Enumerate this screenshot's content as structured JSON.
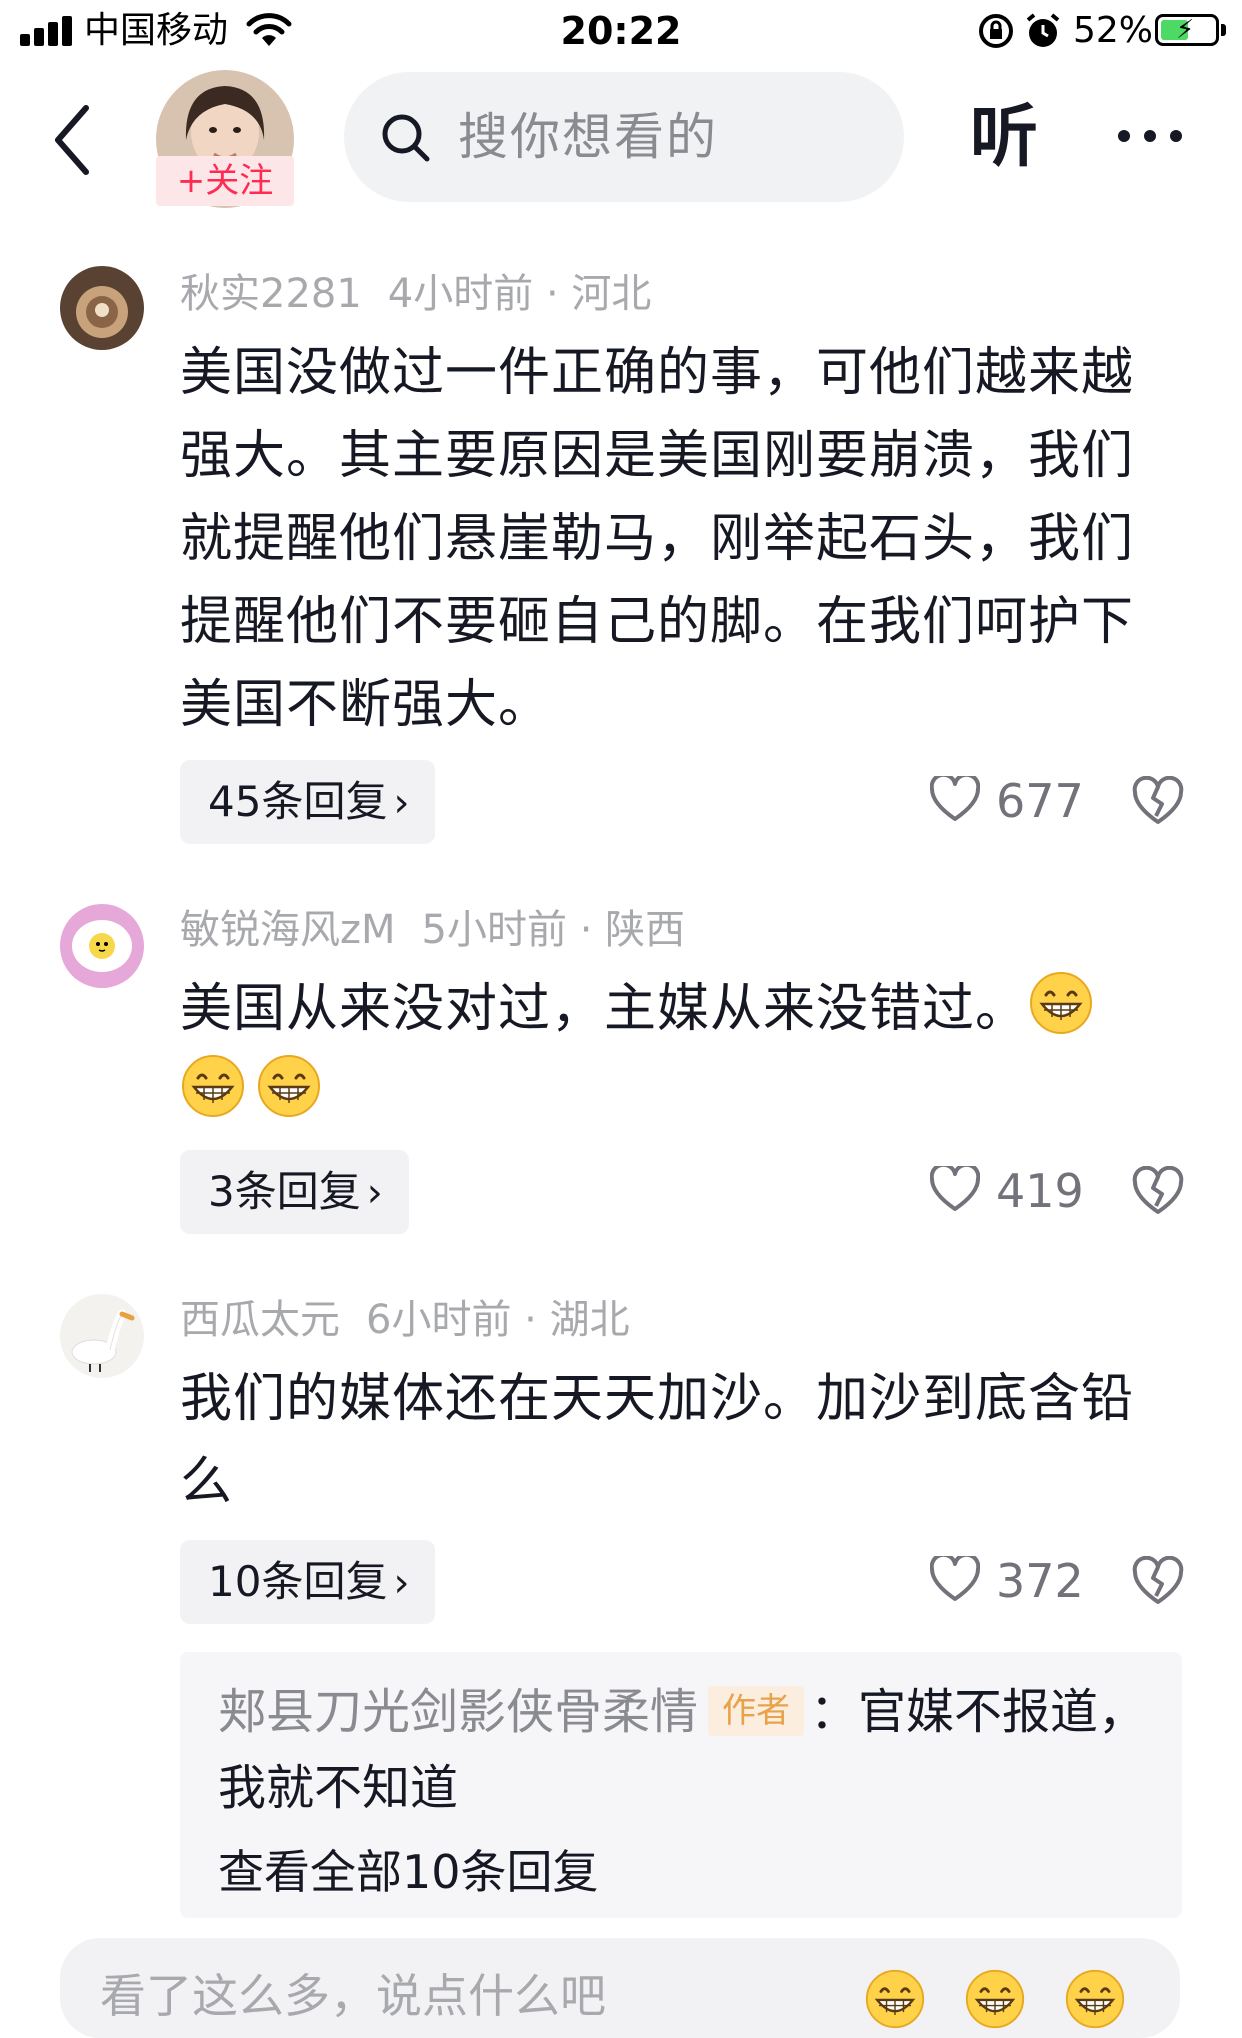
{
  "status_bar": {
    "carrier": "中国移动",
    "time": "20:22",
    "battery_percent": "52%",
    "battery_level": 0.52,
    "icons": [
      "signal-icon",
      "wifi-icon",
      "rotation-lock-icon",
      "alarm-icon",
      "battery-charging-icon"
    ]
  },
  "header": {
    "follow_label": "+关注",
    "search_placeholder": "搜你想看的",
    "listen_label": "听",
    "icons": [
      "back-icon",
      "search-icon",
      "more-icon"
    ]
  },
  "comments": [
    {
      "username": "秋实2281",
      "time": "4小时前",
      "separator": "·",
      "location": "河北",
      "text": "美国没做过一件正确的事，可他们越来越强大。其主要原因是美国刚要崩溃，我们就提醒他们悬崖勒马，刚举起石头，我们提醒他们不要砸自己的脚。在我们呵护下美国不断强大。",
      "replies_label": "45条回复",
      "likes": "677"
    },
    {
      "username": "敏锐海风zM",
      "time": "5小时前",
      "separator": "·",
      "location": "陕西",
      "text": "美国从来没对过，主媒从来没错过。",
      "emoji": "grinning-face-emoji",
      "emoji_count": 3,
      "replies_label": "3条回复",
      "likes": "419"
    },
    {
      "username": "西瓜太元",
      "time": "6小时前",
      "separator": "·",
      "location": "湖北",
      "text": "我们的媒体还在天天加沙。加沙到底含铅么",
      "replies_label": "10条回复",
      "likes": "372",
      "top_reply": {
        "username": "郏县刀光剑影侠骨柔情",
        "badge": "作者",
        "text_line1": "：官媒不报道，",
        "text_line2": "我就不知道",
        "view_all": "查看全部10条回复"
      }
    }
  ],
  "bottom_bar": {
    "placeholder": "看了这么多，说点什么吧"
  },
  "colors": {
    "follow": "#fe2c55",
    "meta_text": "#a8a9ad",
    "author_badge": "#e8a24a"
  }
}
